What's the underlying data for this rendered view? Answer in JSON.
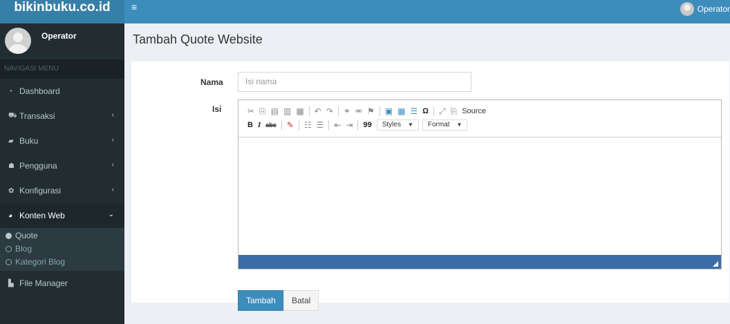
{
  "header": {
    "logo": "bikinbuku.co.id",
    "toggle": "≡",
    "user_name": "Operator"
  },
  "sidebar": {
    "user_name": "Operator",
    "nav_header": "NAVIGASI MENU",
    "items": [
      {
        "label": "Dashboard",
        "icon": "dashboard-icon"
      },
      {
        "label": "Transaksi",
        "icon": "cart-icon"
      },
      {
        "label": "Buku",
        "icon": "book-icon"
      },
      {
        "label": "Pengguna",
        "icon": "users-icon"
      },
      {
        "label": "Konfigurasi",
        "icon": "gear-icon"
      },
      {
        "label": "Konten Web",
        "icon": "pie-icon"
      },
      {
        "label": "File Manager",
        "icon": "file-icon"
      }
    ],
    "submenu": [
      {
        "label": "Quote"
      },
      {
        "label": "Blog"
      },
      {
        "label": "Kategori Blog"
      }
    ]
  },
  "page": {
    "title": "Tambah Quote Website"
  },
  "form": {
    "nama_label": "Nama",
    "nama_placeholder": "Isi nama",
    "isi_label": "Isi",
    "editor": {
      "source_label": "Source",
      "bold": "B",
      "italic": "I",
      "strike": "abc",
      "quote": "99",
      "styles_label": "Styles",
      "format_label": "Format"
    },
    "submit_label": "Tambah",
    "cancel_label": "Batal"
  },
  "colors": {
    "primary": "#3c8dbc",
    "sidebar_bg": "#222d32",
    "editor_footer": "#3b6ea8"
  }
}
